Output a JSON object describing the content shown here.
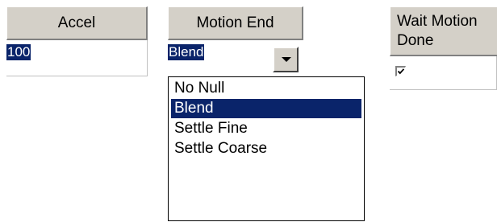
{
  "columns": {
    "accel": {
      "header": "Accel",
      "value": "100"
    },
    "motion_end": {
      "header": "Motion End",
      "value": "Blend",
      "options": [
        "No Null",
        "Blend",
        "Settle Fine",
        "Settle Coarse"
      ],
      "selected_option": "Blend"
    },
    "wait_motion_done": {
      "header_line1": "Wait Motion",
      "header_line2": "Done",
      "checked": true
    }
  },
  "icons": {
    "dropdown": "chevron-down-icon",
    "checkbox": "checkmark-icon"
  },
  "colors": {
    "header_bg": "#d4d0c8",
    "selection": "#0a246a"
  }
}
